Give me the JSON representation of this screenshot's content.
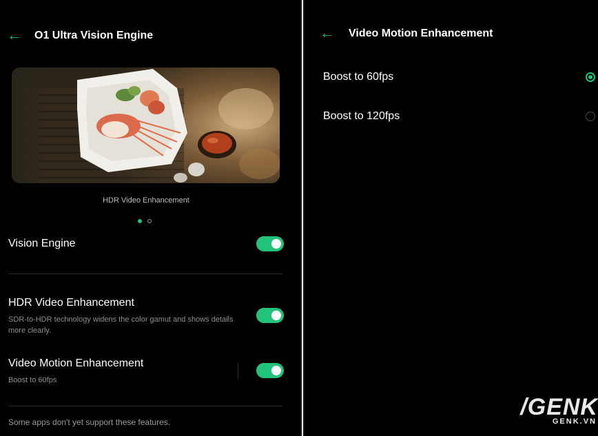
{
  "left": {
    "back_icon": "←",
    "title": "O1 Ultra Vision Engine",
    "caption": "HDR Video Enhancement",
    "rows": [
      {
        "label": "Vision Engine",
        "toggle_on": true
      },
      {
        "label": "HDR Video Enhancement",
        "subtitle": "SDR-to-HDR technology widens the color gamut and shows details more clearly.",
        "toggle_on": true
      },
      {
        "label": "Video Motion Enhancement",
        "subtitle": "Boost to 60fps",
        "toggle_on": true
      }
    ],
    "footnote": "Some apps don't yet support these features."
  },
  "right": {
    "back_icon": "←",
    "title": "Video Motion Enhancement",
    "options": [
      {
        "label": "Boost to 60fps",
        "selected": true
      },
      {
        "label": "Boost to 120fps",
        "selected": false
      }
    ]
  },
  "watermark": {
    "main": "/GENK",
    "sub": "GENK.VN"
  },
  "colors": {
    "accent": "#21c27a",
    "background": "#000000"
  },
  "icons": {
    "back": "back-arrow-icon",
    "toggle": "toggle-switch",
    "radio": "radio-button"
  }
}
